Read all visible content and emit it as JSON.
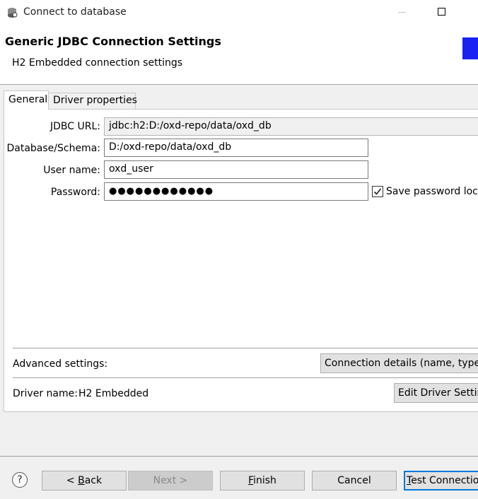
{
  "window": {
    "title": "Connect to database"
  },
  "header": {
    "title": "Generic JDBC Connection Settings",
    "subtitle": "H2 Embedded connection settings"
  },
  "tabs": {
    "general": "General",
    "driver_properties": "Driver properties"
  },
  "form": {
    "jdbc_url_label": "JDBC URL:",
    "jdbc_url_value": "jdbc:h2:D:/oxd-repo/data/oxd_db",
    "database_label": "Database/Schema:",
    "database_value": "D:/oxd-repo/data/oxd_db",
    "username_label": "User name:",
    "username_value": "oxd_user",
    "password_label": "Password:",
    "password_value": "●●●●●●●●●●●●",
    "save_password_label": "Save password loca",
    "save_password_checked": true
  },
  "advanced": {
    "label": "Advanced settings:",
    "button": "Connection details (name, type, ..."
  },
  "driver": {
    "label": "Driver name:",
    "value": "H2 Embedded",
    "button": "Edit Driver Settin"
  },
  "footer": {
    "help": "?",
    "back_underline": "B",
    "back_rest": "ack",
    "next": "Next >",
    "finish_underline": "F",
    "finish_rest": "inish",
    "cancel": "Cancel",
    "test_underline": "T",
    "test_rest": "est Connection"
  },
  "colors": {
    "banner": "#1a22f2",
    "default_button_border": "#0078d7"
  }
}
